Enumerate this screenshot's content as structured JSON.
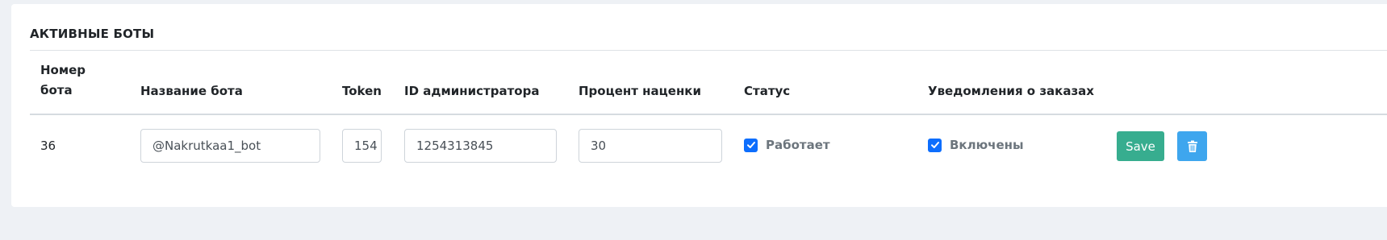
{
  "section": {
    "title": "АКТИВНЫЕ БОТЫ"
  },
  "table": {
    "headers": {
      "number_line1": "Номер",
      "number_line2": "бота",
      "name": "Название бота",
      "token": "Token",
      "admin_id": "ID администратора",
      "markup": "Процент наценки",
      "status": "Статус",
      "notifications": "Уведомления о заказах"
    },
    "rows": [
      {
        "number": "36",
        "name": "@Nakrutkaa1_bot",
        "token": "154",
        "admin_id": "1254313845",
        "markup": "30",
        "status_checked": true,
        "status_label": "Работает",
        "notifications_checked": true,
        "notifications_label": "Включены",
        "save_label": "Save"
      }
    ]
  },
  "icons": {
    "checkbox": "check-icon",
    "delete": "trash-icon"
  },
  "colors": {
    "save": "#37ad8f",
    "delete": "#3ea6ee",
    "checkbox": "#0d6efd"
  }
}
